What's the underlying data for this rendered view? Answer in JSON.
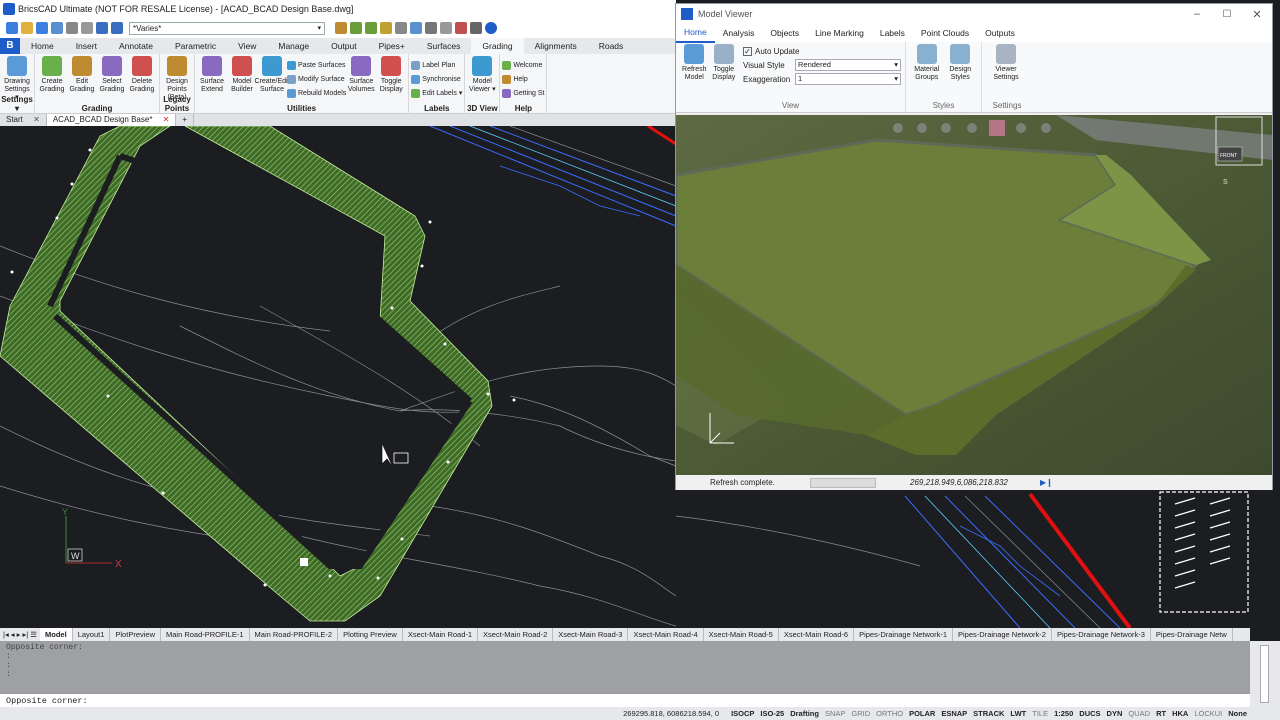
{
  "app": {
    "title": "BricsCAD Ultimate (NOT FOR RESALE License) - [ACAD_BCAD Design Base.dwg]",
    "combo_value": "*Varies*",
    "logo": "B"
  },
  "ribbon_tabs": [
    "Home",
    "Insert",
    "Annotate",
    "Parametric",
    "View",
    "Manage",
    "Output",
    "Pipes+",
    "Surfaces",
    "Grading",
    "Alignments",
    "Roads"
  ],
  "ribbon_active": "Grading",
  "ribbon_groups": [
    {
      "name": "Settings ▾",
      "buttons": [
        "Drawing Settings ▾"
      ],
      "small": []
    },
    {
      "name": "Grading",
      "buttons": [
        "Create Grading",
        "Edit Grading",
        "Select Grading",
        "Delete Grading"
      ],
      "small": []
    },
    {
      "name": "Legacy Points",
      "buttons": [
        "Design Points (Beta)"
      ],
      "small": []
    },
    {
      "name": "Utilities",
      "buttons": [
        "Surface Extend",
        "Model Builder",
        "Create/Edit Surface"
      ],
      "small": [
        "Paste Surfaces",
        "Modify Surface",
        "Rebuild Models"
      ],
      "buttons2": [
        "Surface Volumes",
        "Toggle Display"
      ]
    },
    {
      "name": "Labels",
      "buttons": [],
      "small": [
        "Label Plan",
        "Synchronise",
        "Edit Labels ▾"
      ]
    },
    {
      "name": "3D View",
      "buttons": [
        "Model Viewer ▾"
      ],
      "small": []
    },
    {
      "name": "Help",
      "buttons": [],
      "small": [
        "Welcome",
        "Help",
        "Getting St"
      ]
    }
  ],
  "doc_tabs": [
    "Start",
    "ACAD_BCAD Design Base*"
  ],
  "doc_active": "ACAD_BCAD Design Base*",
  "ucs": {
    "y": "Y",
    "x": "X",
    "w": "W"
  },
  "model_viewer": {
    "title": "Model Viewer",
    "tabs": [
      "Home",
      "Analysis",
      "Objects",
      "Line Marking",
      "Labels",
      "Point Clouds",
      "Outputs"
    ],
    "active_tab": "Home",
    "buttons": [
      "Refresh Model",
      "Toggle Display"
    ],
    "auto_update_label": "Auto Update",
    "auto_update_checked": true,
    "visual_style_label": "Visual Style",
    "visual_style_value": "Rendered",
    "exaggeration_label": "Exaggeration",
    "exaggeration_value": "1",
    "group_view": "View",
    "style_buttons": [
      "Material Groups",
      "Design Styles"
    ],
    "group_styles": "Styles",
    "settings_buttons": [
      "Viewer Settings"
    ],
    "group_settings": "Settings",
    "status": "Refresh complete.",
    "coords": "269,218.949,6,086,218.832",
    "cube_label": "FRONT",
    "compass": "S"
  },
  "layout_tabs": [
    "Model",
    "Layout1",
    "PlotPreview",
    "Main Road-PROFILE-1",
    "Main Road-PROFILE-2",
    "Plotting Preview",
    "Xsect-Main Road-1",
    "Xsect-Main Road-2",
    "Xsect-Main Road-3",
    "Xsect-Main Road-4",
    "Xsect-Main Road-5",
    "Xsect-Main Road-6",
    "Pipes-Drainage Network-1",
    "Pipes-Drainage Network-2",
    "Pipes-Drainage Network-3",
    "Pipes-Drainage Netw"
  ],
  "layout_active": "Model",
  "command_history": [
    "Opposite corner:",
    ":",
    ":",
    ":"
  ],
  "command_prompt": "Opposite corner:",
  "statusbar": {
    "coords": "269295.818, 6086218.594, 0",
    "items": [
      {
        "label": "ISOCP",
        "on": true
      },
      {
        "label": "ISO-25",
        "on": true
      },
      {
        "label": "Drafting",
        "on": true
      },
      {
        "label": "SNAP",
        "on": false
      },
      {
        "label": "GRID",
        "on": false
      },
      {
        "label": "ORTHO",
        "on": false
      },
      {
        "label": "POLAR",
        "on": true
      },
      {
        "label": "ESNAP",
        "on": true
      },
      {
        "label": "STRACK",
        "on": true
      },
      {
        "label": "LWT",
        "on": true
      },
      {
        "label": "TILE",
        "on": false
      },
      {
        "label": "1:250",
        "on": true
      },
      {
        "label": "DUCS",
        "on": true
      },
      {
        "label": "DYN",
        "on": true
      },
      {
        "label": "QUAD",
        "on": false
      },
      {
        "label": "RT",
        "on": true
      },
      {
        "label": "HKA",
        "on": true
      },
      {
        "label": "LOCKUI",
        "on": false
      },
      {
        "label": "None",
        "on": true
      }
    ]
  },
  "colors": {
    "grading_green": "#7fb85a",
    "drawing_bg": "#1b1d21",
    "accent_blue": "#1e5cc8",
    "road_red": "#e01010",
    "pipe_blue": "#3a6cff"
  }
}
